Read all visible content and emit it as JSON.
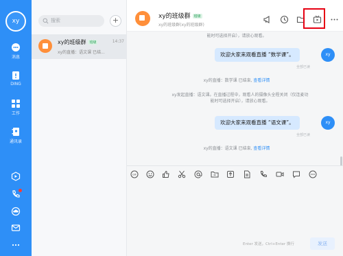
{
  "user": {
    "avatar_text": "xy"
  },
  "nav": [
    {
      "label": "消息",
      "icon": "message-icon"
    },
    {
      "label": "DING",
      "icon": "ding-icon"
    },
    {
      "label": "工作",
      "icon": "work-icon"
    },
    {
      "label": "通讯录",
      "icon": "contacts-icon"
    }
  ],
  "rail_bottom_icons": [
    "live-icon",
    "phone-icon",
    "cloud-icon",
    "mail-icon",
    "more-icon"
  ],
  "search": {
    "placeholder": "搜索"
  },
  "add_label": "+",
  "conversation": {
    "name": "xy的班级群",
    "tag": "班级",
    "time": "14:37",
    "preview": "xy的直播：语文课 已结..."
  },
  "header": {
    "title": "xy的班级群",
    "tag": "班级",
    "subtitle": "xy的班级群(xy的班级群)"
  },
  "header_icons": [
    "announcement-icon",
    "history-icon",
    "folder-icon",
    "live-room-icon",
    "more-icon"
  ],
  "messages": {
    "sys_top_clip": "能时可选择开启），请放心观看。",
    "msg1": "欢迎大家来观看直播 “数学课”。",
    "read1": "全部已读",
    "sys1_text": "xy的直播：数学课 已结束,",
    "sys1_link": "查看详情",
    "sys2_line1": "xy发起直播：语文课。在直播过程中，观看人的摄像头全程关闭（仅连麦功",
    "sys2_line2": "能时可选择开启），请放心观看。",
    "msg2": "欢迎大家来观看直播 “语文课”。",
    "read2": "全部已读",
    "sys3_text": "xy的直播：语文课 已结束,",
    "sys3_link": "查看详情",
    "me_avatar": "xy"
  },
  "toolbar_icons": [
    "gif-icon",
    "emoji-icon",
    "like-icon",
    "scissors-icon",
    "at-icon",
    "folder-icon",
    "upload-icon",
    "doc-icon",
    "phone-icon",
    "video-icon",
    "chat-icon",
    "dots-icon"
  ],
  "input": {
    "hint": "Enter 发送，Ctrl+Enter 换行",
    "send_label": "发送"
  },
  "colors": {
    "accent": "#2e8ff7",
    "highlight_box": "#e60012",
    "bubble": "#d6e9ff",
    "group_logo": "#ff8f3a"
  }
}
